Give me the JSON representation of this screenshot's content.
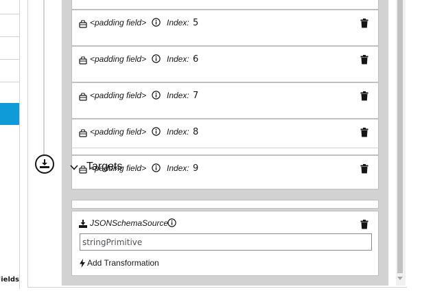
{
  "sidebar": {
    "fields_label": "Fields"
  },
  "targets": {
    "label": "Targets"
  },
  "padding_fields": [
    {
      "name": "<padding field>",
      "index_label": "Index:",
      "index_value": "5"
    },
    {
      "name": "<padding field>",
      "index_label": "Index:",
      "index_value": "6"
    },
    {
      "name": "<padding field>",
      "index_label": "Index:",
      "index_value": "7"
    },
    {
      "name": "<padding field>",
      "index_label": "Index:",
      "index_value": "8"
    },
    {
      "name": "<padding field>",
      "index_label": "Index:",
      "index_value": "9"
    }
  ],
  "source": {
    "title": "JSONSchemaSource",
    "field_value": "stringPrimitive",
    "add_transformation_label": "Add Transformation"
  },
  "colors": {
    "selected_row": "#0f9bd7",
    "mapping_column": "#d2d2d2",
    "card_border": "#bfbfbf"
  }
}
